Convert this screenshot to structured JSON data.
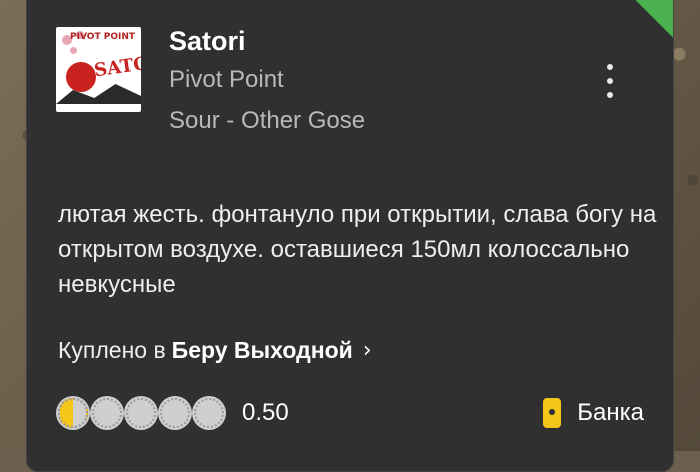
{
  "beer": {
    "name": "Satori",
    "brewery": "Pivot Point",
    "style": "Sour - Other Gose",
    "label_logo_text": "SATORI",
    "label_brand_text": "PIVOT POINT"
  },
  "review": {
    "text": "лютая жесть. фонтануло при открытии, слава богу на открытом воздухе. оставшиеся 150мл колоссально невкусные"
  },
  "purchase": {
    "prefix": "Куплено в",
    "venue": "Беру Выходной",
    "chevron": "›"
  },
  "rating": {
    "value": "0.50",
    "max_caps": 5,
    "filled_fraction": 0.1
  },
  "serving": {
    "type": "Банка",
    "icon": "can-icon"
  },
  "colors": {
    "card_bg": "#303030",
    "accent_yellow": "#f5c518",
    "verified_green": "#4caf50"
  }
}
